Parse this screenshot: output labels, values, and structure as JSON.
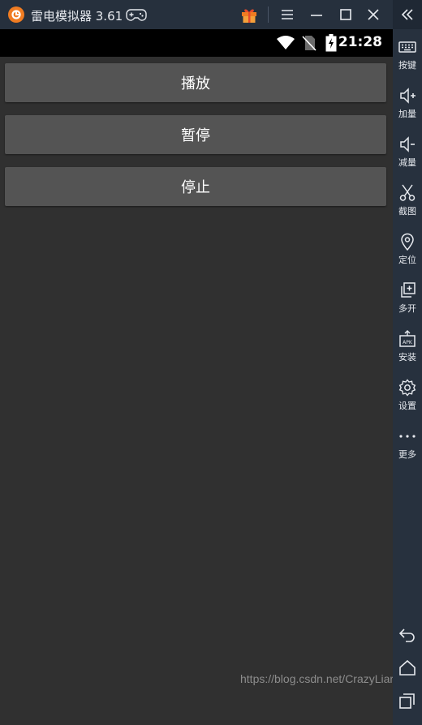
{
  "window": {
    "title": "雷电模拟器 3.61",
    "accent": "#f07c22"
  },
  "statusbar": {
    "time": "21:28"
  },
  "app": {
    "buttons": [
      {
        "label": "播放"
      },
      {
        "label": "暂停"
      },
      {
        "label": "停止"
      }
    ]
  },
  "sidebar": {
    "items": [
      {
        "label": "按键",
        "icon": "keyboard-icon"
      },
      {
        "label": "加量",
        "icon": "volume-up-icon"
      },
      {
        "label": "减量",
        "icon": "volume-down-icon"
      },
      {
        "label": "截图",
        "icon": "scissors-icon"
      },
      {
        "label": "定位",
        "icon": "location-pin-icon"
      },
      {
        "label": "多开",
        "icon": "multi-instance-icon"
      },
      {
        "label": "安装",
        "icon": "apk-install-icon"
      },
      {
        "label": "设置",
        "icon": "gear-icon"
      },
      {
        "label": "更多",
        "icon": "more-dots-icon"
      }
    ]
  },
  "watermark": "https://blog.csdn.net/CrazyLiar"
}
